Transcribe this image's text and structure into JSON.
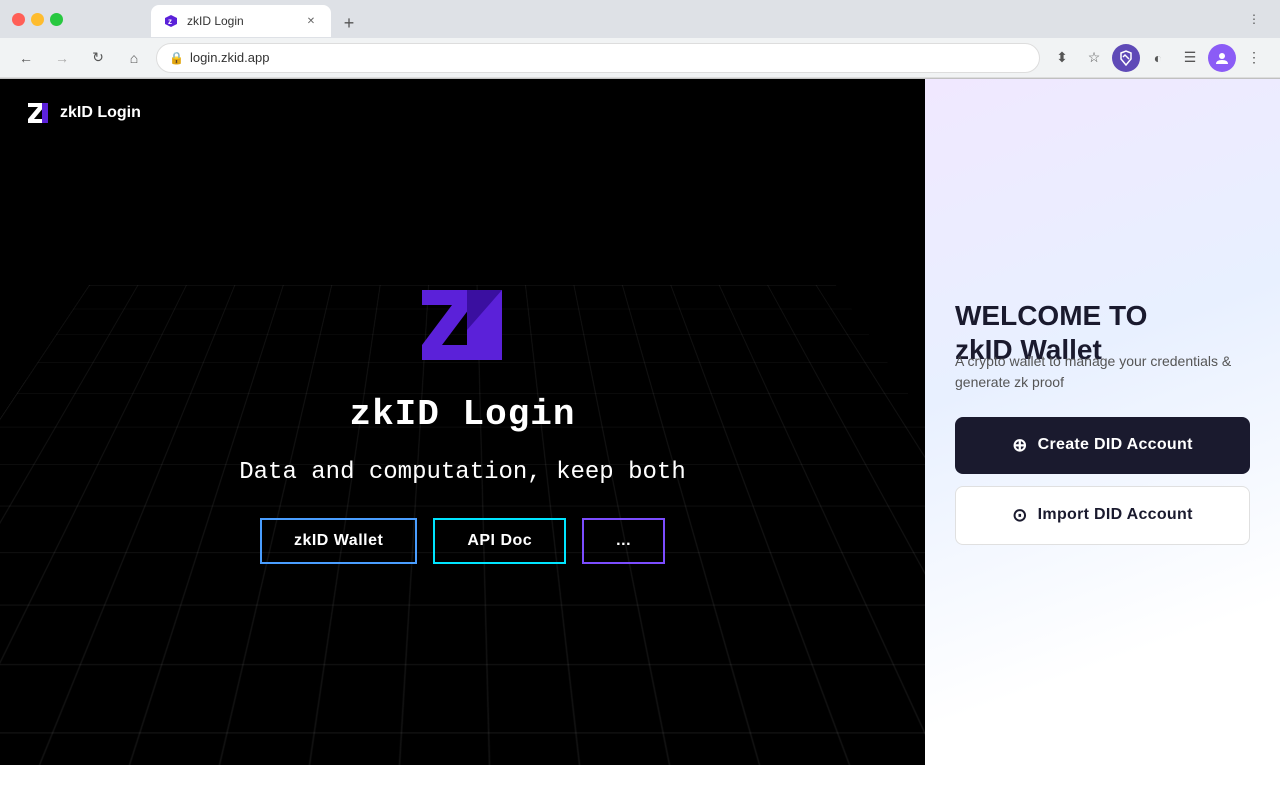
{
  "browser": {
    "tab_title": "zkID Login",
    "address": "login.zkid.app",
    "new_tab_icon": "+",
    "back_disabled": false,
    "forward_disabled": true
  },
  "header": {
    "logo_text": "zkID Login"
  },
  "hero": {
    "title": "zkID Login",
    "tagline": "Data and computation, keep both",
    "btn_wallet": "zkID Wallet",
    "btn_api": "API Doc"
  },
  "right_panel": {
    "welcome_line1": "WELCOME TO",
    "welcome_line2": "zkID Wallet",
    "subtitle": "A crypto wallet to manage your credentials & generate zk proof",
    "create_btn": "Create DID Account",
    "import_btn": "Import DID Account"
  }
}
